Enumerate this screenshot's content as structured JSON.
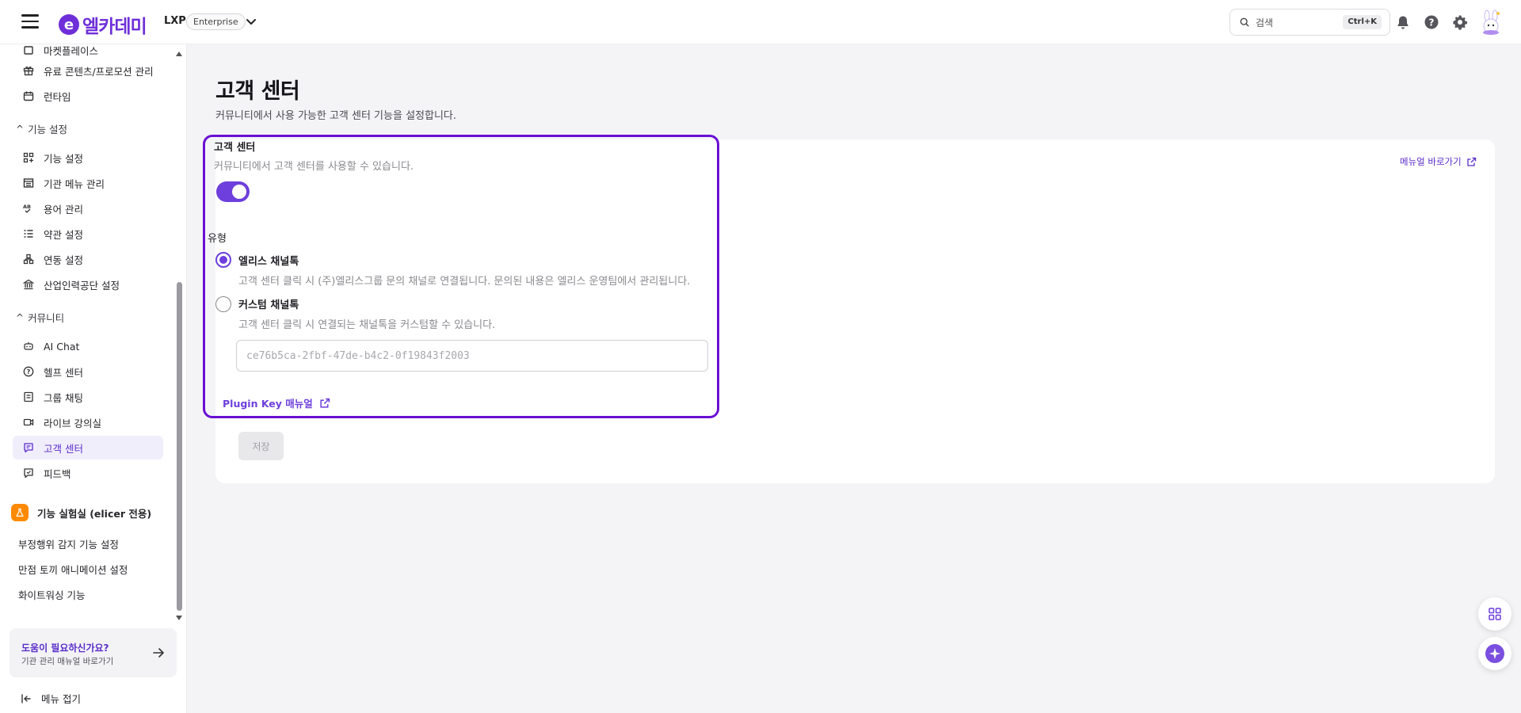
{
  "header": {
    "logo_mark": "e",
    "logo_text": "엘카데미",
    "product": "LXP",
    "plan_badge": "Enterprise",
    "search_placeholder": "검색",
    "search_shortcut": "Ctrl+K"
  },
  "sidebar": {
    "top_items": [
      {
        "label": "마켓플레이스",
        "icon": "store-icon"
      },
      {
        "label": "유료 콘텐츠/프로모션 관리",
        "icon": "gift-icon"
      },
      {
        "label": "런타임",
        "icon": "runtime-icon"
      }
    ],
    "sections": [
      {
        "label": "기능 설정",
        "items": [
          {
            "label": "기능 설정",
            "icon": "feature-grid-icon"
          },
          {
            "label": "기관 메뉴 관리",
            "icon": "menu-list-icon"
          },
          {
            "label": "용어 관리",
            "icon": "abc-icon"
          },
          {
            "label": "약관 설정",
            "icon": "terms-list-icon"
          },
          {
            "label": "연동 설정",
            "icon": "integration-icon"
          },
          {
            "label": "산업인력공단 설정",
            "icon": "institution-icon"
          }
        ]
      },
      {
        "label": "커뮤니티",
        "items": [
          {
            "label": "AI Chat",
            "icon": "robot-icon"
          },
          {
            "label": "헬프 센터",
            "icon": "help-circle-icon"
          },
          {
            "label": "그룹 채팅",
            "icon": "chat-book-icon"
          },
          {
            "label": "라이브 강의실",
            "icon": "video-icon"
          },
          {
            "label": "고객 센터",
            "icon": "customer-chat-icon"
          },
          {
            "label": "피드백",
            "icon": "feedback-icon"
          }
        ]
      }
    ],
    "lab": {
      "label": "기능 실험실 (elicer 전용)",
      "items": [
        "부정행위 감지 기능 설정",
        "만점 토끼 애니메이션 설정",
        "화이트워싱 기능"
      ]
    },
    "help_card": {
      "title": "도움이 필요하신가요?",
      "subtitle": "기관 관리 매뉴얼 바로가기"
    },
    "collapse_label": "메뉴 접기"
  },
  "main": {
    "title": "고객 센터",
    "description": "커뮤니티에서 사용 가능한 고객 센터 기능을 설정합니다.",
    "manual_link": "메뉴얼 바로가기",
    "section_title": "고객 센터",
    "section_desc": "커뮤니티에서 고객 센터를 사용할 수 있습니다.",
    "toggle_on": true,
    "type_label": "유형",
    "options": [
      {
        "title": "엘리스 채널톡",
        "desc": "고객 센터 클릭 시 (주)엘리스그룹 문의 채널로 연결됩니다. 문의된 내용은 엘리스 운영팀에서 관리됩니다.",
        "selected": true
      },
      {
        "title": "커스텀 채널톡",
        "desc": "고객 센터 클릭 시 연결되는 채널톡을 커스텀할 수 있습니다.",
        "selected": false
      }
    ],
    "plugin_key_placeholder": "ce76b5ca-2fbf-47de-b4c2-0f19843f2003",
    "plugin_link": "Plugin Key 매뉴얼",
    "save_label": "저장"
  },
  "colors": {
    "accent": "#6e3fdc",
    "highlight": "#6a0fd3",
    "lab_icon": "#ff8a00"
  }
}
